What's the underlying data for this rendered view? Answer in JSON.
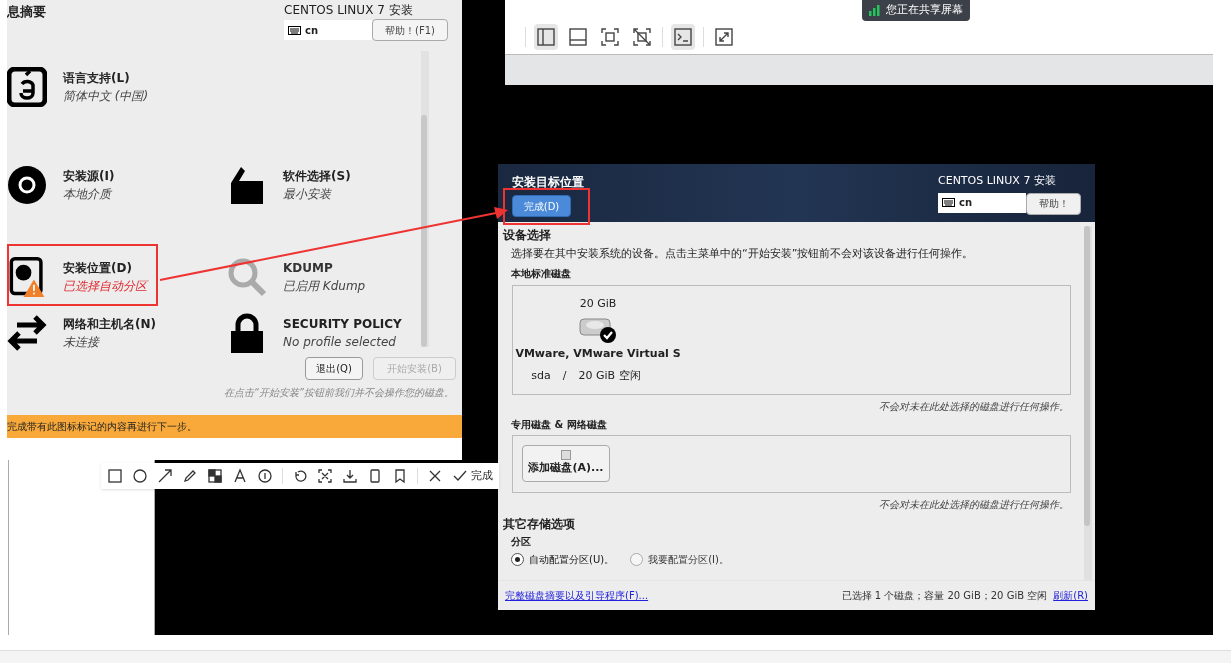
{
  "screen_share_banner": "您正在共享屏幕",
  "vm_toolbar": [
    {
      "kind": "sidebar",
      "selected": true
    },
    {
      "kind": "panel",
      "selected": false
    },
    {
      "kind": "fit",
      "selected": false
    },
    {
      "kind": "unfit",
      "selected": false
    },
    {
      "kind": "console",
      "selected": true
    },
    {
      "kind": "fullscreen",
      "selected": false
    }
  ],
  "summary_window": {
    "title": "息摘要",
    "product": "CENTOS LINUX 7 安装",
    "keyboard": "cn",
    "help_button": "帮助！(F1)",
    "spoke_rows": [
      [
        {
          "kind": "language",
          "title": "语言支持(L)",
          "status": "简体中文 (中国)",
          "warning": false,
          "disabled": false
        }
      ],
      [
        {
          "kind": "source",
          "title": "安装源(I)",
          "status": "本地介质",
          "warning": false,
          "disabled": false
        },
        {
          "kind": "software",
          "title": "软件选择(S)",
          "status": "最小安装",
          "warning": false,
          "disabled": false
        }
      ],
      [
        {
          "kind": "destination",
          "title": "安装位置(D)",
          "status": "已选择自动分区",
          "warning": true,
          "disabled": false
        },
        {
          "kind": "kdump",
          "title": "KDUMP",
          "status": "已启用 Kdump",
          "warning": false,
          "disabled": true
        }
      ],
      [
        {
          "kind": "network",
          "title": "网络和主机名(N)",
          "status": "未连接",
          "warning": false,
          "disabled": false
        },
        {
          "kind": "security",
          "title": "SECURITY POLICY",
          "status": "No profile selected",
          "warning": false,
          "disabled": false
        }
      ]
    ],
    "buttons": [
      {
        "label": "退出(Q)",
        "disabled": false
      },
      {
        "label": "开始安装(B)",
        "disabled": true
      }
    ],
    "note": "在点击“开始安装”按钮前我们并不会操作您的磁盘。",
    "warning_bar": "完成带有此图标标记的内容再进行下一步。"
  },
  "capture_toolbar": {
    "done_label": "完成"
  },
  "target_dialog": {
    "title": "安装目标位置",
    "done_button": "完成(D)",
    "product": "CENTOS LINUX 7 安装",
    "keyboard": "cn",
    "help_button": "帮助！",
    "device_heading": "设备选择",
    "description": "选择要在其中安装系统的设备。点击主菜单中的“开始安装”按钮前不会对该设备进行任何操作。",
    "local_heading": "本地标准磁盘",
    "disks": [
      {
        "size": "20 GiB",
        "name": "VMware, VMware Virtual S",
        "device": "sda",
        "separator": "/",
        "free": "20 GiB 空闲",
        "selected": true
      }
    ],
    "local_note": "不会对未在此处选择的磁盘进行任何操作。",
    "special_heading": "专用磁盘 & 网络磁盘",
    "add_disk_button": "添加磁盘(A)...",
    "special_note": "不会对未在此处选择的磁盘进行任何操作。",
    "other_heading": "其它存储选项",
    "partition_heading": "分区",
    "partition_options": [
      {
        "label": "自动配置分区(U)。",
        "selected": true
      },
      {
        "label": "我要配置分区(I)。",
        "selected": false
      }
    ],
    "summary_link": "完整磁盘摘要以及引导程序(F)...",
    "status": "已选择 1 个磁盘；容量 20 GiB；20 GiB 空闲",
    "refresh_link": "刷新(R)"
  }
}
